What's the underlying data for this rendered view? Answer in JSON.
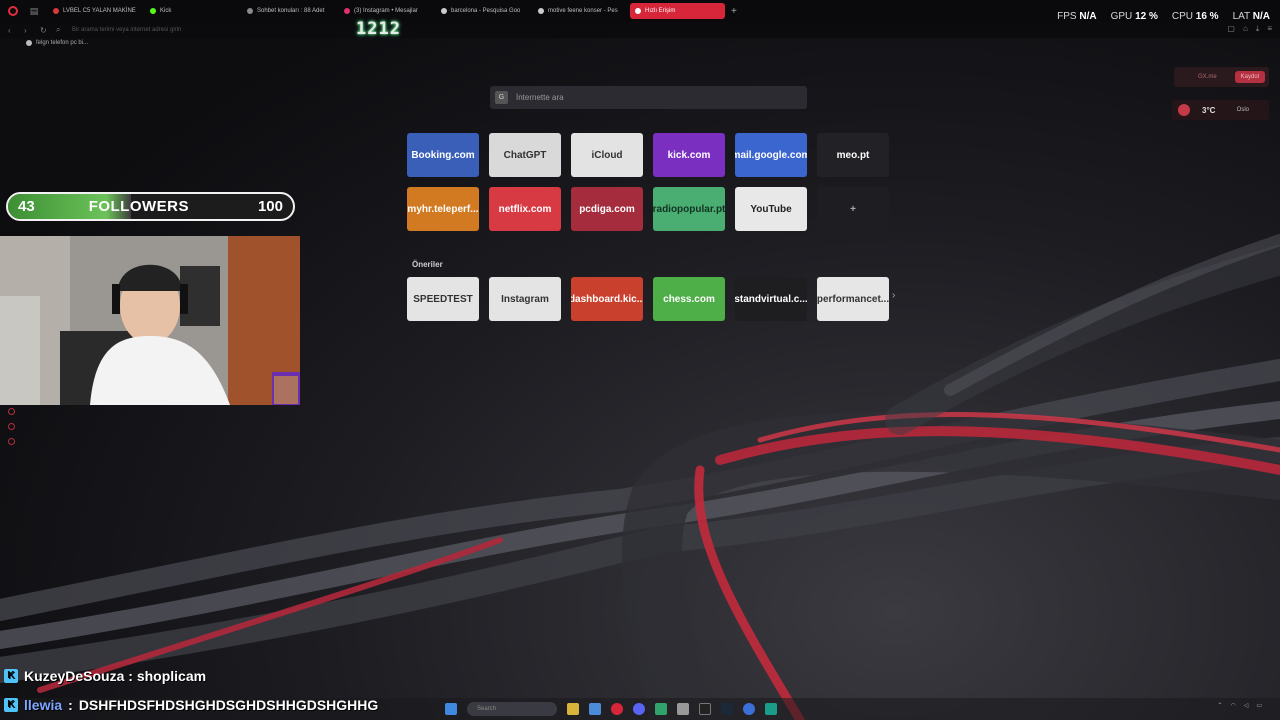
{
  "browser": {
    "tabs": [
      {
        "label": "LVBEL C5 YALAN MAKİNE",
        "color": "#d63a3a"
      },
      {
        "label": "Kick",
        "color": "#53fc18"
      },
      {
        "label": "Sohbet konuları : 88 Adet",
        "color": "#8a8a8a"
      },
      {
        "label": "(3) Instagram • Mesajlar",
        "color": "#e1306c"
      },
      {
        "label": "barcelona - Pesquisa Goo",
        "color": "#cccccc"
      },
      {
        "label": "motive feene konser - Pes",
        "color": "#cccccc"
      },
      {
        "label": "Hızlı Erişim",
        "color": "#ffffff",
        "active": true
      }
    ],
    "address_placeholder": "Bir arama terimi veya internet adresi girin",
    "bookmark": "felgn telefon pc bi..."
  },
  "hud": {
    "fps_label": "FPS",
    "fps_value": "N/A",
    "gpu_label": "GPU",
    "gpu_value": "12 %",
    "cpu_label": "CPU",
    "cpu_value": "16 %",
    "lat_label": "LAT",
    "lat_value": "N/A"
  },
  "overlay_counter": "1212",
  "speed_dial": {
    "search_placeholder": "İnternette ara",
    "tiles": [
      {
        "label": "Booking.com",
        "bg": "#3a5fb8"
      },
      {
        "label": "ChatGPT",
        "bg": "#d9d9d9",
        "fg": "#333333"
      },
      {
        "label": "iCloud",
        "bg": "#e3e3e3",
        "fg": "#333333"
      },
      {
        "label": "kick.com",
        "bg": "#7a2fc0"
      },
      {
        "label": "mail.google.com",
        "bg": "#3c66cf"
      },
      {
        "label": "meo.pt",
        "bg": "#222226"
      },
      {
        "label": "myhr.teleperf...",
        "bg": "#d27a22"
      },
      {
        "label": "netflix.com",
        "bg": "#d83a44"
      },
      {
        "label": "pcdiga.com",
        "bg": "#a52c3c"
      },
      {
        "label": "radiopopular.pt",
        "bg": "#4aad72",
        "fg": "#123322"
      },
      {
        "label": "YouTube",
        "bg": "#e8e8e8",
        "fg": "#222222"
      },
      {
        "label": "+",
        "bg": "#1e1e22",
        "fg": "#aaaaaa"
      }
    ],
    "suggestions_title": "Öneriler",
    "suggestions": [
      {
        "label": "SPEEDTEST",
        "bg": "#e4e4e4",
        "fg": "#333333"
      },
      {
        "label": "Instagram",
        "bg": "#e4e4e4",
        "fg": "#333333"
      },
      {
        "label": "dashboard.kic...",
        "bg": "#c9412d"
      },
      {
        "label": "chess.com",
        "bg": "#4eae47"
      },
      {
        "label": "standvirtual.c...",
        "bg": "#1e1e20"
      },
      {
        "label": "performancet...",
        "bg": "#e6e6e6",
        "fg": "#333333"
      }
    ]
  },
  "widgets": {
    "gx_label": "GX.me",
    "gx_button": "Kaydol",
    "weather_temp": "3°C",
    "weather_city": "Oslo"
  },
  "followers_goal": {
    "current": "43",
    "label": "FOLLOWERS",
    "target": "100",
    "progress": 0.43
  },
  "chat": {
    "line1": {
      "user": "KuzeyDeSouza",
      "sep": " : ",
      "message": "shoplicam"
    },
    "line2": {
      "user": "llewia",
      "sep": " : ",
      "message": "DSHFHDSFHDSHGHDSGHDSHHGDSHGHHG"
    }
  },
  "taskbar": {
    "search_placeholder": "Search"
  }
}
